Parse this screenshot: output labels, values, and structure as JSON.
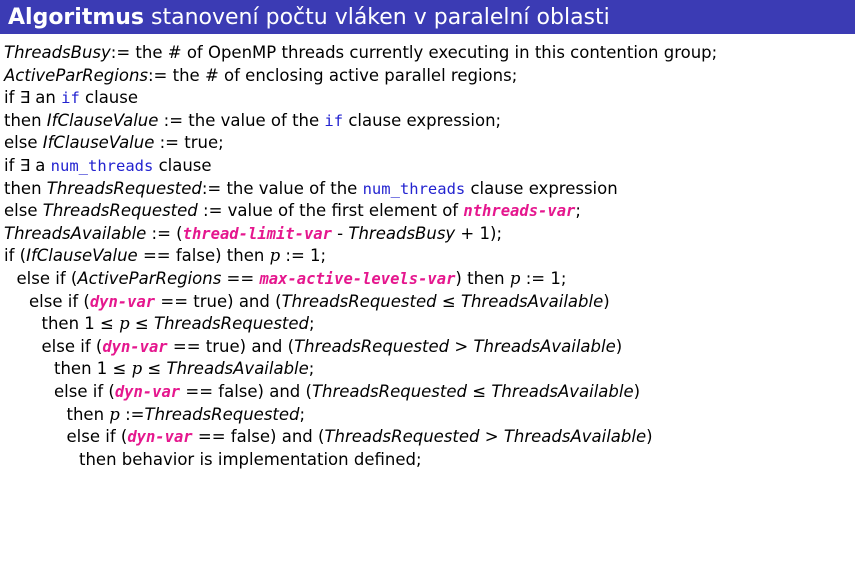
{
  "title": {
    "bold": "Algoritmus",
    "rest": "stanovení počtu vláken v paralelní oblasti"
  },
  "lines": [
    {
      "indent": 0,
      "segs": [
        {
          "t": "ThreadsBusy",
          "s": "it"
        },
        {
          "t": ":= the # of OpenMP threads currently executing in this contention group;"
        }
      ]
    },
    {
      "indent": 0,
      "segs": [
        {
          "t": "ActiveParRegions",
          "s": "it"
        },
        {
          "t": ":= the # of enclosing active parallel regions;"
        }
      ]
    },
    {
      "indent": 0,
      "segs": [
        {
          "t": "if ∃ an "
        },
        {
          "t": "if",
          "s": "kw"
        },
        {
          "t": " clause"
        }
      ]
    },
    {
      "indent": 0,
      "segs": [
        {
          "t": "then "
        },
        {
          "t": "IfClauseValue",
          "s": "it"
        },
        {
          "t": " := the value of the "
        },
        {
          "t": "if",
          "s": "kw"
        },
        {
          "t": " clause expression;"
        }
      ]
    },
    {
      "indent": 0,
      "segs": [
        {
          "t": "else "
        },
        {
          "t": "IfClauseValue",
          "s": "it"
        },
        {
          "t": " := true;"
        }
      ]
    },
    {
      "indent": 0,
      "segs": [
        {
          "t": "if ∃ a "
        },
        {
          "t": "num_threads",
          "s": "kw"
        },
        {
          "t": " clause"
        }
      ]
    },
    {
      "indent": 0,
      "segs": [
        {
          "t": "then "
        },
        {
          "t": "ThreadsRequested",
          "s": "it"
        },
        {
          "t": ":= the value of the "
        },
        {
          "t": "num_threads",
          "s": "kw"
        },
        {
          "t": " clause expression"
        }
      ]
    },
    {
      "indent": 0,
      "segs": [
        {
          "t": "else "
        },
        {
          "t": "ThreadsRequested",
          "s": "it"
        },
        {
          "t": " := value of the first element of "
        },
        {
          "t": "nthreads-var",
          "s": "icv"
        },
        {
          "t": ";"
        }
      ]
    },
    {
      "indent": 0,
      "segs": [
        {
          "t": "ThreadsAvailable",
          "s": "it"
        },
        {
          "t": " := ("
        },
        {
          "t": "thread-limit-var",
          "s": "icv"
        },
        {
          "t": " - "
        },
        {
          "t": "ThreadsBusy",
          "s": "it"
        },
        {
          "t": " + 1);"
        }
      ]
    },
    {
      "indent": 0,
      "segs": [
        {
          "t": "if ("
        },
        {
          "t": "IfClauseValue",
          "s": "it"
        },
        {
          "t": " == false) then "
        },
        {
          "t": "p",
          "s": "m"
        },
        {
          "t": " := 1;"
        }
      ]
    },
    {
      "indent": 1,
      "segs": [
        {
          "t": "else if ("
        },
        {
          "t": "ActiveParRegions",
          "s": "it"
        },
        {
          "t": " == "
        },
        {
          "t": "max-active-levels-var",
          "s": "icv"
        },
        {
          "t": ") then "
        },
        {
          "t": "p",
          "s": "m"
        },
        {
          "t": " := 1;"
        }
      ]
    },
    {
      "indent": 2,
      "segs": [
        {
          "t": "else if ("
        },
        {
          "t": "dyn-var",
          "s": "icv"
        },
        {
          "t": " == true) and ("
        },
        {
          "t": "ThreadsRequested",
          "s": "it"
        },
        {
          "t": " ≤ "
        },
        {
          "t": "ThreadsAvailable",
          "s": "it"
        },
        {
          "t": ")"
        }
      ]
    },
    {
      "indent": 3,
      "segs": [
        {
          "t": "then 1 ≤ "
        },
        {
          "t": "p",
          "s": "m"
        },
        {
          "t": " ≤ "
        },
        {
          "t": "ThreadsRequested",
          "s": "it"
        },
        {
          "t": ";"
        }
      ]
    },
    {
      "indent": 3,
      "segs": [
        {
          "t": "else if ("
        },
        {
          "t": "dyn-var",
          "s": "icv"
        },
        {
          "t": " == true) and ("
        },
        {
          "t": "ThreadsRequested",
          "s": "it"
        },
        {
          "t": " > "
        },
        {
          "t": "ThreadsAvailable",
          "s": "it"
        },
        {
          "t": ")"
        }
      ]
    },
    {
      "indent": 4,
      "segs": [
        {
          "t": "then 1 ≤ "
        },
        {
          "t": "p",
          "s": "m"
        },
        {
          "t": " ≤ "
        },
        {
          "t": "ThreadsAvailable",
          "s": "it"
        },
        {
          "t": ";"
        }
      ]
    },
    {
      "indent": 4,
      "segs": [
        {
          "t": "else if ("
        },
        {
          "t": "dyn-var",
          "s": "icv"
        },
        {
          "t": " == false) and ("
        },
        {
          "t": "ThreadsRequested",
          "s": "it"
        },
        {
          "t": " ≤ "
        },
        {
          "t": "ThreadsAvailable",
          "s": "it"
        },
        {
          "t": ")"
        }
      ]
    },
    {
      "indent": 5,
      "segs": [
        {
          "t": "then "
        },
        {
          "t": "p",
          "s": "m"
        },
        {
          "t": " :="
        },
        {
          "t": "ThreadsRequested",
          "s": "it"
        },
        {
          "t": ";"
        }
      ]
    },
    {
      "indent": 5,
      "segs": [
        {
          "t": "else if ("
        },
        {
          "t": "dyn-var",
          "s": "icv"
        },
        {
          "t": " == false) and ("
        },
        {
          "t": "ThreadsRequested",
          "s": "it"
        },
        {
          "t": " > "
        },
        {
          "t": "ThreadsAvailable",
          "s": "it"
        },
        {
          "t": ")"
        }
      ]
    },
    {
      "indent": 6,
      "segs": [
        {
          "t": "then behavior is implementation defined;"
        }
      ]
    }
  ]
}
